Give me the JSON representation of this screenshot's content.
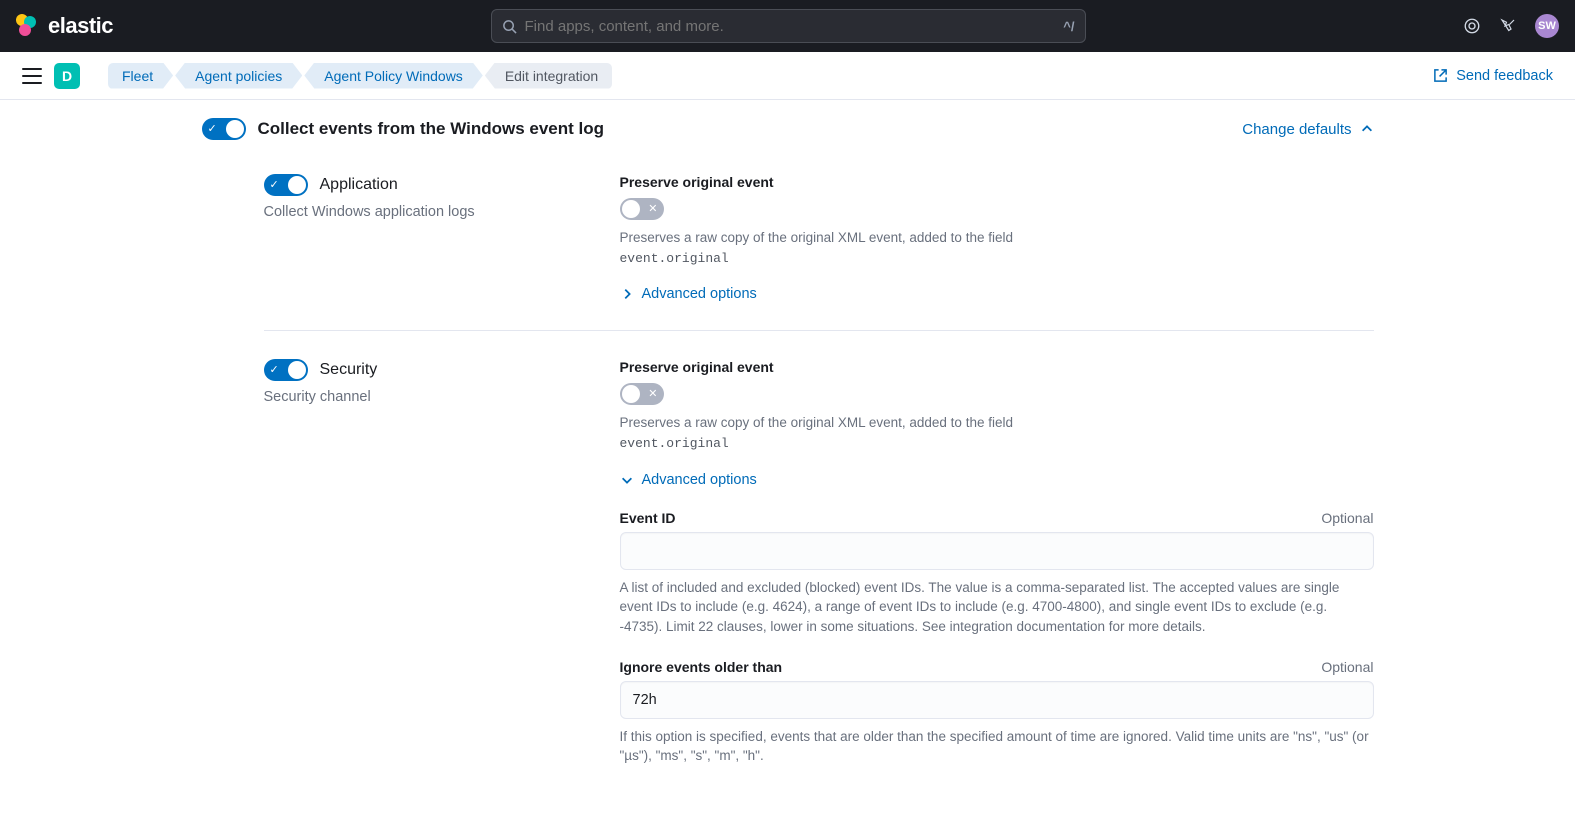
{
  "brand": "elastic",
  "search": {
    "placeholder": "Find apps, content, and more.",
    "shortcut": "^/"
  },
  "avatar": "SW",
  "space_badge": "D",
  "breadcrumbs": [
    "Fleet",
    "Agent policies",
    "Agent Policy Windows",
    "Edit integration"
  ],
  "feedback_label": "Send feedback",
  "section": {
    "title": "Collect events from the Windows event log",
    "toggle_on": true,
    "change_defaults": "Change defaults"
  },
  "channels": {
    "application": {
      "title": "Application",
      "desc": "Collect Windows application logs",
      "toggle_on": true,
      "preserve": {
        "label": "Preserve original event",
        "toggle_on": false,
        "help_pre": "Preserves a raw copy of the original XML event, added to the field ",
        "help_code": "event.original"
      },
      "advanced_label": "Advanced options",
      "advanced_expanded": false
    },
    "security": {
      "title": "Security",
      "desc": "Security channel",
      "toggle_on": true,
      "preserve": {
        "label": "Preserve original event",
        "toggle_on": false,
        "help_pre": "Preserves a raw copy of the original XML event, added to the field ",
        "help_code": "event.original"
      },
      "advanced_label": "Advanced options",
      "advanced_expanded": true,
      "event_id": {
        "label": "Event ID",
        "optional": "Optional",
        "value": "",
        "help": "A list of included and excluded (blocked) event IDs. The value is a comma-separated list. The accepted values are single event IDs to include (e.g. 4624), a range of event IDs to include (e.g. 4700-4800), and single event IDs to exclude (e.g. -4735). Limit 22 clauses, lower in some situations. See integration documentation for more details."
      },
      "ignore_older": {
        "label": "Ignore events older than",
        "optional": "Optional",
        "value": "72h",
        "help": "If this option is specified, events that are older than the specified amount of time are ignored. Valid time units are \"ns\", \"us\" (or \"µs\"), \"ms\", \"s\", \"m\", \"h\"."
      }
    }
  }
}
